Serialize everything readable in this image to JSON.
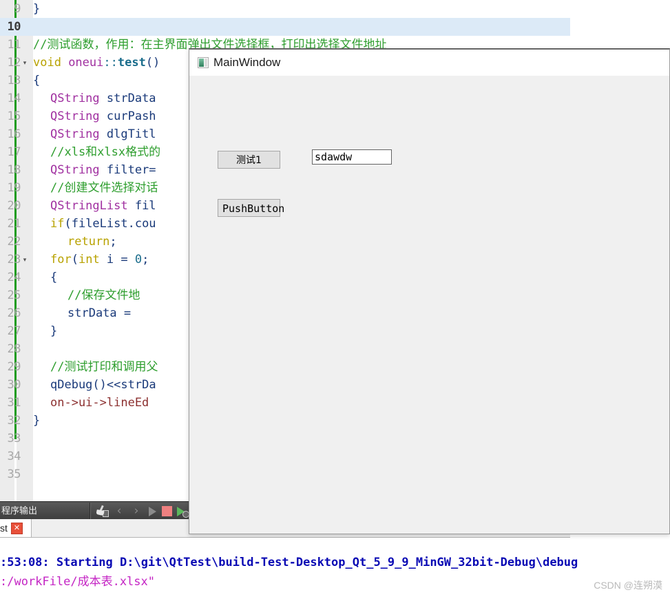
{
  "editor": {
    "lines": [
      {
        "num": "9",
        "fold": "",
        "highlight": false,
        "tokens": [
          {
            "t": "}",
            "c": "c-pln"
          }
        ],
        "indent": 0
      },
      {
        "num": "10",
        "fold": "",
        "highlight": true,
        "tokens": [],
        "indent": 0
      },
      {
        "num": "11",
        "fold": "",
        "highlight": false,
        "tokens": [
          {
            "t": "//测试函数，作用：在主界面弹出文件选择框，打印出选择文件地址",
            "c": "c-cmt"
          }
        ],
        "indent": 0
      },
      {
        "num": "12",
        "fold": "▾",
        "highlight": false,
        "tokens": [
          {
            "t": "void ",
            "c": "c-kw"
          },
          {
            "t": "oneui",
            "c": "c-typ"
          },
          {
            "t": "::",
            "c": "c-op"
          },
          {
            "t": "test",
            "c": "c-fn"
          },
          {
            "t": "()",
            "c": "c-pln"
          }
        ],
        "indent": 0
      },
      {
        "num": "13",
        "fold": "",
        "highlight": false,
        "tokens": [
          {
            "t": "{",
            "c": "c-pln"
          }
        ],
        "indent": 0
      },
      {
        "num": "14",
        "fold": "",
        "highlight": false,
        "tokens": [
          {
            "t": "QString",
            "c": "c-typ"
          },
          {
            "t": " strData",
            "c": "c-var"
          }
        ],
        "indent": 1
      },
      {
        "num": "15",
        "fold": "",
        "highlight": false,
        "tokens": [
          {
            "t": "QString",
            "c": "c-typ"
          },
          {
            "t": " curPash",
            "c": "c-var"
          }
        ],
        "indent": 1
      },
      {
        "num": "16",
        "fold": "",
        "highlight": false,
        "tokens": [
          {
            "t": "QString",
            "c": "c-typ"
          },
          {
            "t": " dlgTitl",
            "c": "c-var"
          }
        ],
        "indent": 1
      },
      {
        "num": "17",
        "fold": "",
        "highlight": false,
        "tokens": [
          {
            "t": "//xls和xlsx格式的",
            "c": "c-cmt"
          }
        ],
        "indent": 1
      },
      {
        "num": "18",
        "fold": "",
        "highlight": false,
        "tokens": [
          {
            "t": "QString",
            "c": "c-typ"
          },
          {
            "t": " filter=",
            "c": "c-var"
          }
        ],
        "indent": 1
      },
      {
        "num": "19",
        "fold": "",
        "highlight": false,
        "tokens": [
          {
            "t": "//创建文件选择对话",
            "c": "c-cmt"
          }
        ],
        "indent": 1
      },
      {
        "num": "20",
        "fold": "",
        "highlight": false,
        "tokens": [
          {
            "t": "QStringList",
            "c": "c-typ"
          },
          {
            "t": " fil",
            "c": "c-var"
          }
        ],
        "indent": 1
      },
      {
        "num": "21",
        "fold": "",
        "highlight": false,
        "tokens": [
          {
            "t": "if",
            "c": "c-ctl"
          },
          {
            "t": "(fileList.cou",
            "c": "c-var"
          }
        ],
        "indent": 1
      },
      {
        "num": "22",
        "fold": "",
        "highlight": false,
        "tokens": [
          {
            "t": "return",
            "c": "c-ctl"
          },
          {
            "t": ";",
            "c": "c-pln"
          }
        ],
        "indent": 2
      },
      {
        "num": "23",
        "fold": "▾",
        "highlight": false,
        "tokens": [
          {
            "t": "for",
            "c": "c-ctl"
          },
          {
            "t": "(",
            "c": "c-pln"
          },
          {
            "t": "int",
            "c": "c-kw"
          },
          {
            "t": " i = ",
            "c": "c-var"
          },
          {
            "t": "0",
            "c": "c-num"
          },
          {
            "t": ";",
            "c": "c-pln"
          }
        ],
        "indent": 1
      },
      {
        "num": "24",
        "fold": "",
        "highlight": false,
        "tokens": [
          {
            "t": "{",
            "c": "c-pln"
          }
        ],
        "indent": 1
      },
      {
        "num": "25",
        "fold": "",
        "highlight": false,
        "tokens": [
          {
            "t": "//保存文件地",
            "c": "c-cmt"
          }
        ],
        "indent": 2
      },
      {
        "num": "26",
        "fold": "",
        "highlight": false,
        "tokens": [
          {
            "t": "strData = ",
            "c": "c-var"
          }
        ],
        "indent": 2
      },
      {
        "num": "27",
        "fold": "",
        "highlight": false,
        "tokens": [
          {
            "t": "}",
            "c": "c-pln"
          }
        ],
        "indent": 1
      },
      {
        "num": "28",
        "fold": "",
        "highlight": false,
        "tokens": [],
        "indent": 0
      },
      {
        "num": "29",
        "fold": "",
        "highlight": false,
        "tokens": [
          {
            "t": "//测试打印和调用父",
            "c": "c-cmt"
          }
        ],
        "indent": 1
      },
      {
        "num": "30",
        "fold": "",
        "highlight": false,
        "tokens": [
          {
            "t": "qDebug",
            "c": "c-var"
          },
          {
            "t": "()<<",
            "c": "c-pln"
          },
          {
            "t": "strDa",
            "c": "c-var"
          }
        ],
        "indent": 1
      },
      {
        "num": "31",
        "fold": "",
        "highlight": false,
        "tokens": [
          {
            "t": "on->ui->lineEd",
            "c": "c-mem"
          }
        ],
        "indent": 1
      },
      {
        "num": "32",
        "fold": "",
        "highlight": false,
        "tokens": [
          {
            "t": "}",
            "c": "c-pln"
          }
        ],
        "indent": 0
      },
      {
        "num": "33",
        "fold": "",
        "highlight": false,
        "tokens": [],
        "indent": 0
      },
      {
        "num": "34",
        "fold": "",
        "highlight": false,
        "tokens": [],
        "indent": 0
      },
      {
        "num": "35",
        "fold": "",
        "highlight": false,
        "tokens": [],
        "indent": 0
      }
    ]
  },
  "output_pane": {
    "title": "程序输出",
    "toolbar": [
      {
        "name": "clear-output-icon",
        "label": "clear"
      },
      {
        "name": "prev-item-icon",
        "label": "‹"
      },
      {
        "name": "next-item-icon",
        "label": "›"
      },
      {
        "name": "run-icon",
        "label": "run"
      },
      {
        "name": "stop-icon",
        "label": "stop"
      },
      {
        "name": "rerun-icon",
        "label": "rerun"
      }
    ],
    "tab_label": "st",
    "tab_close": "✕"
  },
  "console": {
    "line1": ":53:08: Starting D:\\git\\QtTest\\build-Test-Desktop_Qt_5_9_9_MinGW_32bit-Debug\\debug",
    "line2": ":/workFile/成本表.xlsx\"",
    "watermark": "CSDN @连朔漠"
  },
  "mainwindow": {
    "title": "MainWindow",
    "button_test1": "测试1",
    "button_push": "PushButton",
    "line_edit_value": "sdawdw",
    "line_edit_placeholder": ""
  },
  "colors": {
    "comment": "#2e9e2e",
    "keyword": "#b8a200",
    "type": "#a030a0",
    "function": "#1b6d8c",
    "member": "#8c3030",
    "console_cmd": "#0a0ab4",
    "console_path": "#c425c4",
    "gutter_green": "#1a9c1a",
    "highlight_line": "#dceaf7",
    "stop_red": "#ef8080",
    "run_green": "#5cb85c"
  }
}
